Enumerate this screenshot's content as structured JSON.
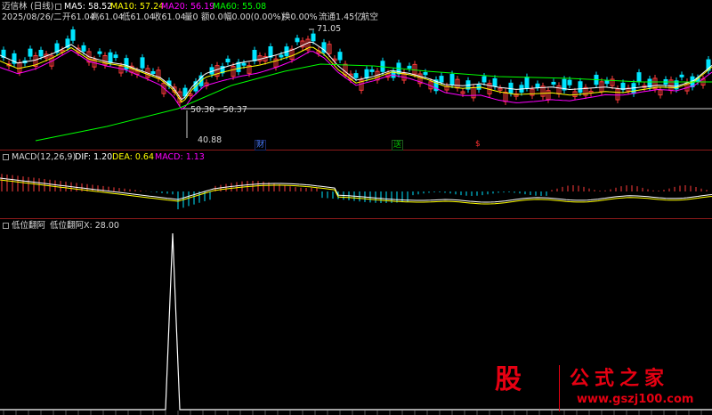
{
  "header": {
    "stock_name": "迈信林",
    "period": "(日线)",
    "ma5_label": "MA5: 58.52",
    "ma10_label": "MA10: 57.24",
    "ma20_label": "MA20: 56.19",
    "ma60_label": "MA60: 55.08",
    "date": "2025/08/26/二",
    "open": "开61.04",
    "high": "高61.04",
    "low": "低61.04",
    "close": "收61.04",
    "volume": "量0",
    "amount": "额0.0",
    "change": "幅0.00(0.00%)",
    "turnover": "换0.00%",
    "float_cap": "流通1.45亿",
    "industry": "航空",
    "colors": {
      "ma5": "#ffffff",
      "ma10": "#ffff00",
      "ma20": "#ff00ff",
      "ma60": "#00ff00"
    }
  },
  "price_annotations": {
    "high_mark": "71.05",
    "range_label": "50.30 - 50.37",
    "low_mark": "40.88"
  },
  "event_flags": [
    {
      "label": "财",
      "color": "#4a7dff"
    },
    {
      "label": "送",
      "color": "#00c000"
    },
    {
      "label": "$",
      "color": "#ff3030"
    }
  ],
  "macd_header": {
    "name": "MACD(12,26,9)",
    "dif": "DIF: 1.20",
    "dea": "DEA: 0.64",
    "macd": "MACD: 1.13"
  },
  "indicator_header": {
    "name": "低位翻阿",
    "series": "低位翻阿X: 28.00"
  },
  "watermark": {
    "ox": "股",
    "title": "公式之家",
    "url": "www.gszj100.com"
  },
  "chart_data": [
    {
      "type": "line",
      "panel": "price",
      "title": "迈信林(日线)",
      "y_annotations": {
        "high": 71.05,
        "low": 40.88,
        "range": [
          50.3,
          50.37
        ]
      },
      "series": [
        {
          "name": "MA5",
          "last": 58.52
        },
        {
          "name": "MA10",
          "last": 57.24
        },
        {
          "name": "MA20",
          "last": 56.19
        },
        {
          "name": "MA60",
          "last": 55.08
        }
      ],
      "last_bar": {
        "date": "2025/08/26",
        "open": 61.04,
        "high": 61.04,
        "low": 61.04,
        "close": 61.04
      }
    },
    {
      "type": "bar",
      "panel": "macd",
      "series": [
        {
          "name": "DIF",
          "last": 1.2
        },
        {
          "name": "DEA",
          "last": 0.64
        },
        {
          "name": "MACD",
          "last": 1.13
        }
      ]
    },
    {
      "type": "line",
      "panel": "indicator",
      "series": [
        {
          "name": "低位翻阿X",
          "last": 28.0
        }
      ]
    }
  ]
}
